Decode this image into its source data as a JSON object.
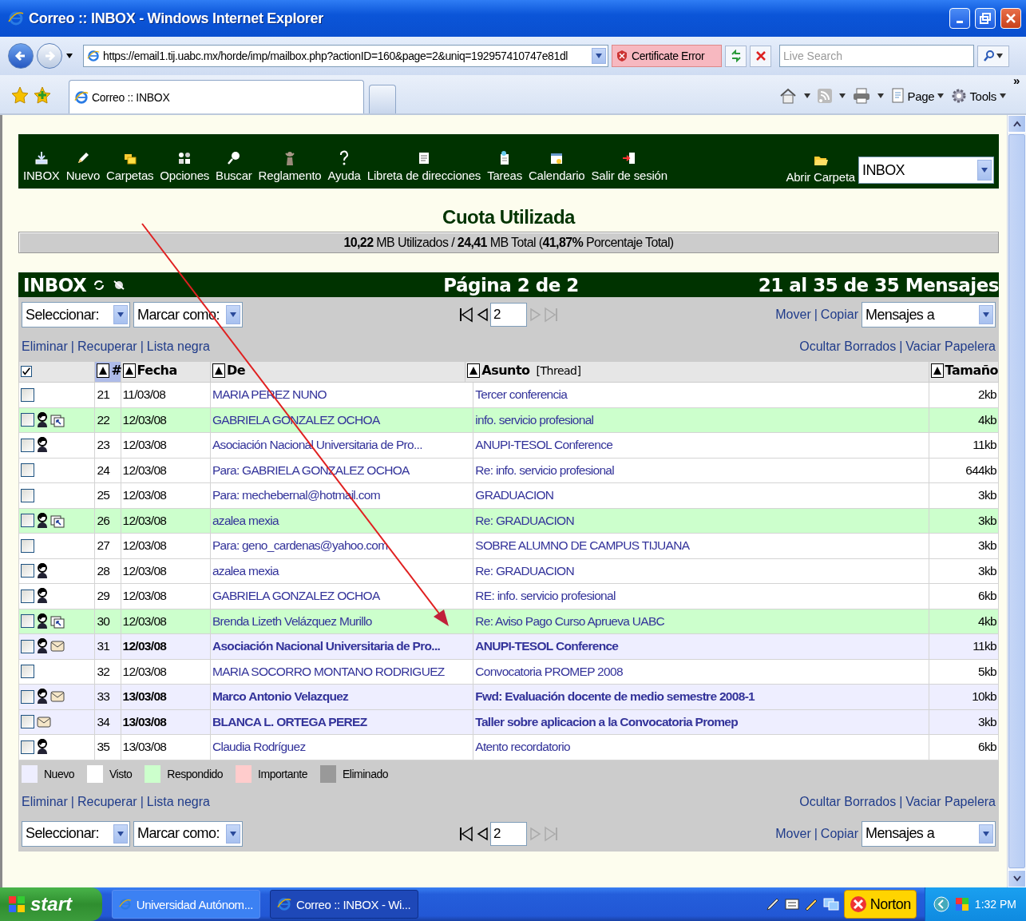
{
  "window": {
    "title": "Correo :: INBOX - Windows Internet Explorer"
  },
  "address_bar": {
    "url": "https://email1.tij.uabc.mx/horde/imp/mailbox.php?actionID=160&page=2&uniq=192957410747e81dl",
    "certificate": "Certificate Error"
  },
  "search": {
    "placeholder": "Live Search"
  },
  "tabs": [
    {
      "label": "Correo :: INBOX",
      "selected": true
    }
  ],
  "command_bar": {
    "items": [
      "Page",
      "Tools"
    ],
    "more": "»"
  },
  "toolbar": {
    "items": [
      "INBOX",
      "Nuevo",
      "Carpetas",
      "Opciones",
      "Buscar",
      "Reglamento",
      "Ayuda",
      "Libreta de direcciones",
      "Tareas",
      "Calendario",
      "Salir de sesión"
    ],
    "open_folder": {
      "label": "Abrir Carpeta",
      "value": "INBOX"
    }
  },
  "quota": {
    "title": "Cuota Utilizada",
    "text": "**10,22** MB Utilizados / **24,41** MB Total (**41,87%** Porcentaje Total)"
  },
  "mailbox": {
    "name": "INBOX",
    "page": "Página 2 de 2",
    "range": "21 al 35 de 35 Mensajes"
  },
  "top": {
    "controls": {
      "select": "Seleccionar:",
      "mark": "Marcar como:",
      "page": "2",
      "next_disabled": true,
      "move": "Mover",
      "separator": "|",
      "copy": "Copiar",
      "target": "Mensajes a"
    },
    "links": {
      "left": [
        "Eliminar",
        "Recuperar",
        "Lista negra"
      ],
      "right": [
        "Ocultar Borrados",
        "Vaciar Papelera"
      ],
      "separator": "|"
    }
  },
  "table": {
    "select_all": {
      "checked": true
    },
    "columns": [
      {
        "label": "#",
        "sorted": true
      },
      {
        "label": "Fecha",
        "sorted": false
      },
      {
        "label": "De",
        "sorted": false
      },
      {
        "label": "Asunto",
        "note": "[Thread]",
        "sorted": false
      },
      {
        "label": "Tamaño",
        "sorted": false
      }
    ],
    "rows": [
      {
        "number": "21",
        "date": "11/03/08",
        "from": "MARIA PEREZ NUNO",
        "subject": "Tercer conferencia",
        "size": "2kb",
        "new": false,
        "replied": false,
        "contact": false,
        "checked": false
      },
      {
        "number": "22",
        "date": "12/03/08",
        "from": "GABRIELA GONZALEZ OCHOA",
        "subject": "info. servicio profesional",
        "size": "4kb",
        "new": false,
        "replied": true,
        "contact": true,
        "checked": false
      },
      {
        "number": "23",
        "date": "12/03/08",
        "from": "Asociación Nacional Universitaria de Pro...",
        "subject": "ANUPI-TESOL Conference",
        "size": "11kb",
        "new": false,
        "replied": false,
        "contact": true,
        "checked": false
      },
      {
        "number": "24",
        "date": "12/03/08",
        "from": "Para: GABRIELA GONZALEZ OCHOA",
        "subject": "Re: info. servicio profesional",
        "size": "644kb",
        "new": false,
        "replied": false,
        "contact": false,
        "checked": false
      },
      {
        "number": "25",
        "date": "12/03/08",
        "from": "Para: mechebernal@hotmail.com",
        "subject": "GRADUACION",
        "size": "3kb",
        "new": false,
        "replied": false,
        "contact": false,
        "checked": false
      },
      {
        "number": "26",
        "date": "12/03/08",
        "from": "azalea mexia",
        "subject": "Re: GRADUACION",
        "size": "3kb",
        "new": false,
        "replied": true,
        "contact": true,
        "checked": false
      },
      {
        "number": "27",
        "date": "12/03/08",
        "from": "Para: geno_cardenas@yahoo.com",
        "subject": "SOBRE ALUMNO DE CAMPUS TIJUANA",
        "size": "3kb",
        "new": false,
        "replied": false,
        "contact": false,
        "checked": false
      },
      {
        "number": "28",
        "date": "12/03/08",
        "from": "azalea mexia",
        "subject": "Re: GRADUACION",
        "size": "3kb",
        "new": false,
        "replied": false,
        "contact": true,
        "checked": false
      },
      {
        "number": "29",
        "date": "12/03/08",
        "from": "GABRIELA GONZALEZ OCHOA",
        "subject": "RE: info. servicio profesional",
        "size": "6kb",
        "new": false,
        "replied": false,
        "contact": true,
        "checked": false
      },
      {
        "number": "30",
        "date": "12/03/08",
        "from": "Brenda Lizeth Velázquez Murillo",
        "subject": "Re: Aviso Pago Curso Aprueva UABC",
        "size": "4kb",
        "new": false,
        "replied": true,
        "contact": true,
        "checked": false
      },
      {
        "number": "31",
        "date": "12/03/08",
        "from": "Asociación Nacional Universitaria de Pro...",
        "subject": "ANUPI-TESOL Conference",
        "size": "11kb",
        "new": true,
        "replied": false,
        "contact": true,
        "checked": false
      },
      {
        "number": "32",
        "date": "12/03/08",
        "from": "MARIA SOCORRO MONTANO RODRIGUEZ",
        "subject": "Convocatoria PROMEP 2008",
        "size": "5kb",
        "new": false,
        "replied": false,
        "contact": false,
        "checked": false
      },
      {
        "number": "33",
        "date": "13/03/08",
        "from": "Marco Antonio Velazquez",
        "subject": "Fwd: Evaluación docente de medio semestre 2008-1",
        "size": "10kb",
        "new": true,
        "replied": false,
        "contact": true,
        "checked": false
      },
      {
        "number": "34",
        "date": "13/03/08",
        "from": "BLANCA L. ORTEGA PEREZ",
        "subject": "Taller sobre aplicacion a la Convocatoria Promep",
        "size": "3kb",
        "new": true,
        "replied": false,
        "contact": false,
        "checked": false
      },
      {
        "number": "35",
        "date": "13/03/08",
        "from": "Claudia Rodríguez",
        "subject": "Atento recordatorio",
        "size": "6kb",
        "new": false,
        "replied": false,
        "contact": true,
        "checked": false
      }
    ]
  },
  "legend": [
    {
      "label": "Nuevo",
      "color": "#eeeeff"
    },
    {
      "label": "Visto",
      "color": "#ffffff"
    },
    {
      "label": "Respondido",
      "color": "#ccffcc"
    },
    {
      "label": "Importante",
      "color": "#ffcccc"
    },
    {
      "label": "Eliminado",
      "color": "#999999"
    }
  ],
  "bottom": {
    "links": {
      "left": [
        "Eliminar",
        "Recuperar",
        "Lista negra"
      ],
      "right": [
        "Ocultar Borrados",
        "Vaciar Papelera"
      ],
      "separator": "|"
    },
    "controls": {
      "select": "Seleccionar:",
      "mark": "Marcar como:",
      "page": "2",
      "next_disabled": true,
      "move": "Mover",
      "separator": "|",
      "copy": "Copiar",
      "target": "Mensajes a"
    }
  },
  "taskbar": {
    "start": "start",
    "tasks": [
      {
        "label": "Universidad Autónom...",
        "selected": false
      },
      {
        "label": "Correo :: INBOX - Wi...",
        "selected": true
      }
    ],
    "norton": "Norton",
    "time": "1:32 PM"
  }
}
